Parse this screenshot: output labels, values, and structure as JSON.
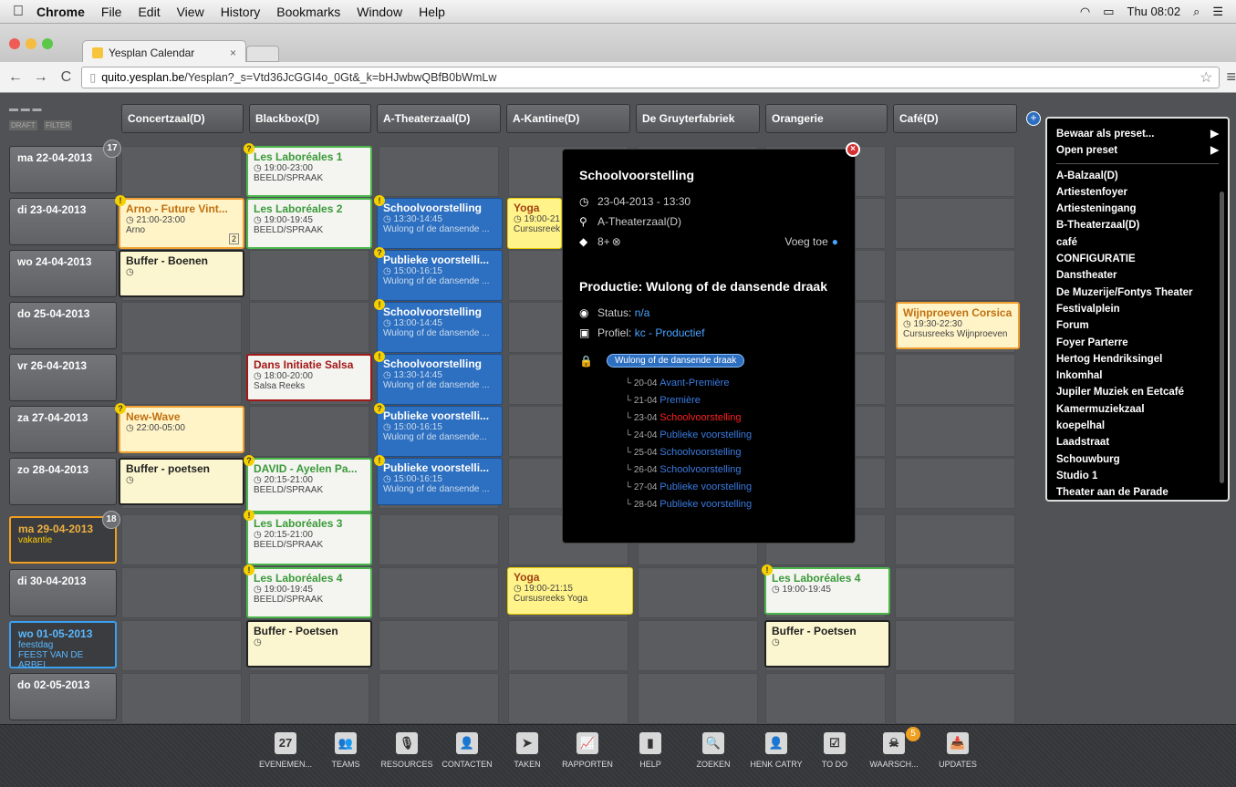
{
  "menubar": {
    "apple": "",
    "items": [
      "Chrome",
      "File",
      "Edit",
      "View",
      "History",
      "Bookmarks",
      "Window",
      "Help"
    ],
    "clock": "Thu 08:02"
  },
  "browser": {
    "tab_title": "Yesplan Calendar",
    "tab_close": "×",
    "url_domain": "quito.yesplan.be",
    "url_path": "/Yesplan?_s=Vtd36JcGGI4o_0Gt&_k=bHJwbwQBfB0bWmLw"
  },
  "toolbar_left": {
    "draft": "DRAFT",
    "filter": "FILTER"
  },
  "columns": [
    "Concertzaal(D)",
    "Blackbox(D)",
    "A-Theaterzaal(D)",
    "A-Kantine(D)",
    "De Gruyterfabriek",
    "Orangerie",
    "Café(D)"
  ],
  "days": [
    {
      "label": "ma   22-04-2013",
      "sub": "",
      "badge": "17"
    },
    {
      "label": "di    23-04-2013",
      "sub": ""
    },
    {
      "label": "wo   24-04-2013",
      "sub": ""
    },
    {
      "label": "do   25-04-2013",
      "sub": ""
    },
    {
      "label": "vr    26-04-2013",
      "sub": ""
    },
    {
      "label": "za   27-04-2013",
      "sub": ""
    },
    {
      "label": "zo   28-04-2013",
      "sub": ""
    },
    {
      "label": "ma   29-04-2013",
      "sub": "vakantie",
      "badge": "18"
    },
    {
      "label": "di    30-04-2013",
      "sub": ""
    },
    {
      "label": "wo   01-05-2013",
      "sub": "feestdag\nFEEST VAN DE ARBEI"
    },
    {
      "label": "do   02-05-2013",
      "sub": ""
    }
  ],
  "events": {
    "e1": {
      "title": "Les Laboréales 1",
      "time": "19:00-23:00",
      "sub": "BEELD/SPRAAK"
    },
    "e2": {
      "title": "Arno - Future Vint...",
      "time": "21:00-23:00",
      "sub": "Arno",
      "count": "2"
    },
    "e3": {
      "title": "Les Laboréales 2",
      "time": "19:00-19:45",
      "sub": "BEELD/SPRAAK"
    },
    "e4": {
      "title": "Schoolvoorstelling",
      "time": "13:30-14:45",
      "sub": "Wulong of de dansende ..."
    },
    "e5": {
      "title": "Yoga",
      "time": "19:00-21",
      "sub": "Cursusreek"
    },
    "e6": {
      "title": "Buffer - Boenen",
      "time": ""
    },
    "e7": {
      "title": "Publieke voorstelli...",
      "time": "15:00-16:15",
      "sub": "Wulong of de dansende ..."
    },
    "e8": {
      "title": "Schoolvoorstelling",
      "time": "13:00-14:45",
      "sub": "Wulong of de dansende ..."
    },
    "e9": {
      "title": "Wijnproeven Corsica",
      "time": "19:30-22:30",
      "sub": "Cursusreeks Wijnproeven"
    },
    "e10": {
      "title": "Dans Initiatie Salsa",
      "time": "18:00-20:00",
      "sub": "Salsa Reeks"
    },
    "e11": {
      "title": "Schoolvoorstelling",
      "time": "13:30-14:45",
      "sub": "Wulong of de dansende ..."
    },
    "e12": {
      "title": "New-Wave",
      "time": "22:00-05:00"
    },
    "e13": {
      "title": "Publieke voorstelli...",
      "time": "15:00-16:15",
      "sub": "Wulong of de dansende..."
    },
    "e14": {
      "title": "Buffer - poetsen",
      "time": ""
    },
    "e15": {
      "title": "DAVID - Ayelen Pa...",
      "time": "20:15-21:00",
      "sub": "BEELD/SPRAAK"
    },
    "e16": {
      "title": "Publieke voorstelli...",
      "time": "15:00-16:15",
      "sub": "Wulong of de dansende ..."
    },
    "e17": {
      "title": "Les Laboréales 3",
      "time": "20:15-21:00",
      "sub": "BEELD/SPRAAK"
    },
    "e18": {
      "title": "Les Laboréales 4",
      "time": "19:00-19:45",
      "sub": "BEELD/SPRAAK"
    },
    "e19": {
      "title": "Yoga",
      "time": "19:00-21:15",
      "sub": "Cursusreeks Yoga"
    },
    "e20": {
      "title": "Les Laboréales 4",
      "time": "19:00-19:45"
    },
    "e21": {
      "title": "Buffer - Poetsen",
      "time": ""
    },
    "e22": {
      "title": "Buffer - Poetsen",
      "time": ""
    }
  },
  "popup": {
    "title": "Schoolvoorstelling",
    "datetime": "23-04-2013 - 13:30",
    "location": "A-Theaterzaal(D)",
    "tags": "8+",
    "add_label": "Voeg toe",
    "production_title": "Productie: Wulong of de dansende draak",
    "status_label": "Status:",
    "status_value": "n/a",
    "profile_label": "Profiel:",
    "profile_value": "kc - Productief",
    "chain_root": "Wulong of de dansende draak",
    "chain": [
      {
        "date": "20-04",
        "name": "Avant-Première"
      },
      {
        "date": "21-04",
        "name": "Première"
      },
      {
        "date": "23-04",
        "name": "Schoolvoorstelling",
        "current": true
      },
      {
        "date": "24-04",
        "name": "Publieke voorstelling"
      },
      {
        "date": "25-04",
        "name": "Schoolvoorstelling"
      },
      {
        "date": "26-04",
        "name": "Schoolvoorstelling"
      },
      {
        "date": "27-04",
        "name": "Publieke voorstelling"
      },
      {
        "date": "28-04",
        "name": "Publieke voorstelling"
      }
    ]
  },
  "dropdown": {
    "top": [
      "Bewaar als preset...",
      "Open preset"
    ],
    "items": [
      "A-Balzaal(D)",
      "Artiestenfoyer",
      "Artiesteningang",
      "B-Theaterzaal(D)",
      "café",
      "CONFIGURATIE",
      "Danstheater",
      "De Muzerije/Fontys Theater",
      "Festivalplein",
      "Forum",
      "Foyer Parterre",
      "Hertog Hendriksingel",
      "Inkomhal",
      "Jupiler Muziek en Eetcafé",
      "Kamermuziekzaal",
      "koepelhal",
      "Laadstraat",
      "Schouwburg",
      "Studio 1",
      "Theater aan de Parade"
    ]
  },
  "toolbar": [
    {
      "icon": "calendar-icon",
      "glyph": "27",
      "label": "EVENEMEN..."
    },
    {
      "icon": "team-icon",
      "glyph": "👥",
      "label": "TEAMS"
    },
    {
      "icon": "microphone-icon",
      "glyph": "🎙",
      "label": "RESOURCES"
    },
    {
      "icon": "contact-icon",
      "glyph": "👤",
      "label": "CONTACTEN"
    },
    {
      "icon": "send-icon",
      "glyph": "➤",
      "label": "TAKEN"
    },
    {
      "icon": "chart-icon",
      "glyph": "📈",
      "label": "RAPPORTEN"
    },
    {
      "icon": "bookmark-icon",
      "glyph": "▮",
      "label": "HELP"
    },
    {
      "icon": "search-icon",
      "glyph": "🔍",
      "label": "ZOEKEN"
    },
    {
      "icon": "user-icon",
      "glyph": "👤",
      "label": "HENK CATRY"
    },
    {
      "icon": "checkbox-icon",
      "glyph": "☑",
      "label": "TO DO"
    },
    {
      "icon": "skull-icon",
      "glyph": "☠",
      "label": "WAARSCH..."
    },
    {
      "icon": "inbox-icon",
      "glyph": "📥",
      "label": "UPDATES"
    }
  ],
  "warnings_badge": "5"
}
